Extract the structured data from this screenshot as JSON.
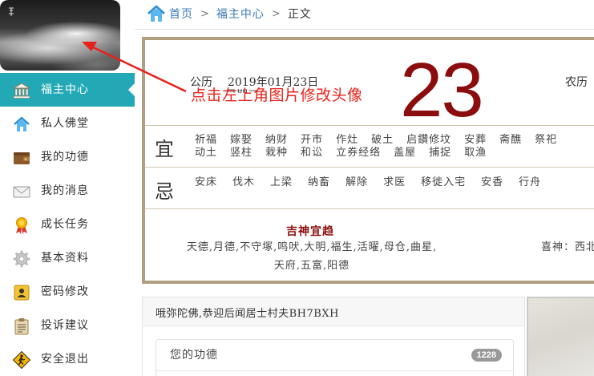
{
  "sidebar": {
    "avatar_alt": "头像",
    "items": [
      {
        "label": "福主中心",
        "icon": "temple-icon",
        "active": true
      },
      {
        "label": "私人佛堂",
        "icon": "home-icon",
        "active": false
      },
      {
        "label": "我的功德",
        "icon": "wallet-icon",
        "active": false
      },
      {
        "label": "我的消息",
        "icon": "envelope-icon",
        "active": false
      },
      {
        "label": "成长任务",
        "icon": "medal-icon",
        "active": false
      },
      {
        "label": "基本资料",
        "icon": "gear-icon",
        "active": false
      },
      {
        "label": "密码修改",
        "icon": "id-card-icon",
        "active": false
      },
      {
        "label": "投诉建议",
        "icon": "clipboard-icon",
        "active": false
      },
      {
        "label": "安全退出",
        "icon": "exit-sign-icon",
        "active": false
      }
    ]
  },
  "breadcrumb": {
    "home": "首页",
    "section": "福主中心",
    "current": "正文",
    "separator": ">"
  },
  "almanac": {
    "gregorian_label": "公历",
    "gregorian_date": "2019年01月23日",
    "sub_line": "星期三",
    "day_number": "23",
    "lunar_label": "农历",
    "yi_label": "宜",
    "yi_row1": [
      "祈福",
      "嫁娶",
      "纳财",
      "开市",
      "作灶",
      "破土",
      "启鑽修坟",
      "安葬",
      "斋醮",
      "祭祀"
    ],
    "yi_row2": [
      "动土",
      "竖柱",
      "栽种",
      "和讼",
      "立券经络",
      "盖屋",
      "捕捉",
      "取渔"
    ],
    "ji_label": "忌",
    "ji_row1": [
      "安床",
      "伐木",
      "上梁",
      "纳畜",
      "解除",
      "求医",
      "移徙入宅",
      "安香",
      "行舟"
    ],
    "gods_title": "吉神宜趋",
    "gods_line1": "天德,月德,不守塚,鸣吠,大明,福生,活曜,母仓,曲星,",
    "gods_line2": "天府,五富,阳德",
    "xi_shen": "喜神：西北"
  },
  "welcome": {
    "text": "哦弥陀佛,恭迎后闻居士村夫BH7BXH",
    "merit_label": "您的功德",
    "merit_count": "1228"
  },
  "annotation": {
    "text": "点击左上角图片修改头像"
  },
  "colors": {
    "active_nav": "#22a9b5",
    "link": "#3d7ab8",
    "day_red": "#8b0d0d",
    "annotation_red": "#e8211a",
    "frame": "#b09f80"
  }
}
